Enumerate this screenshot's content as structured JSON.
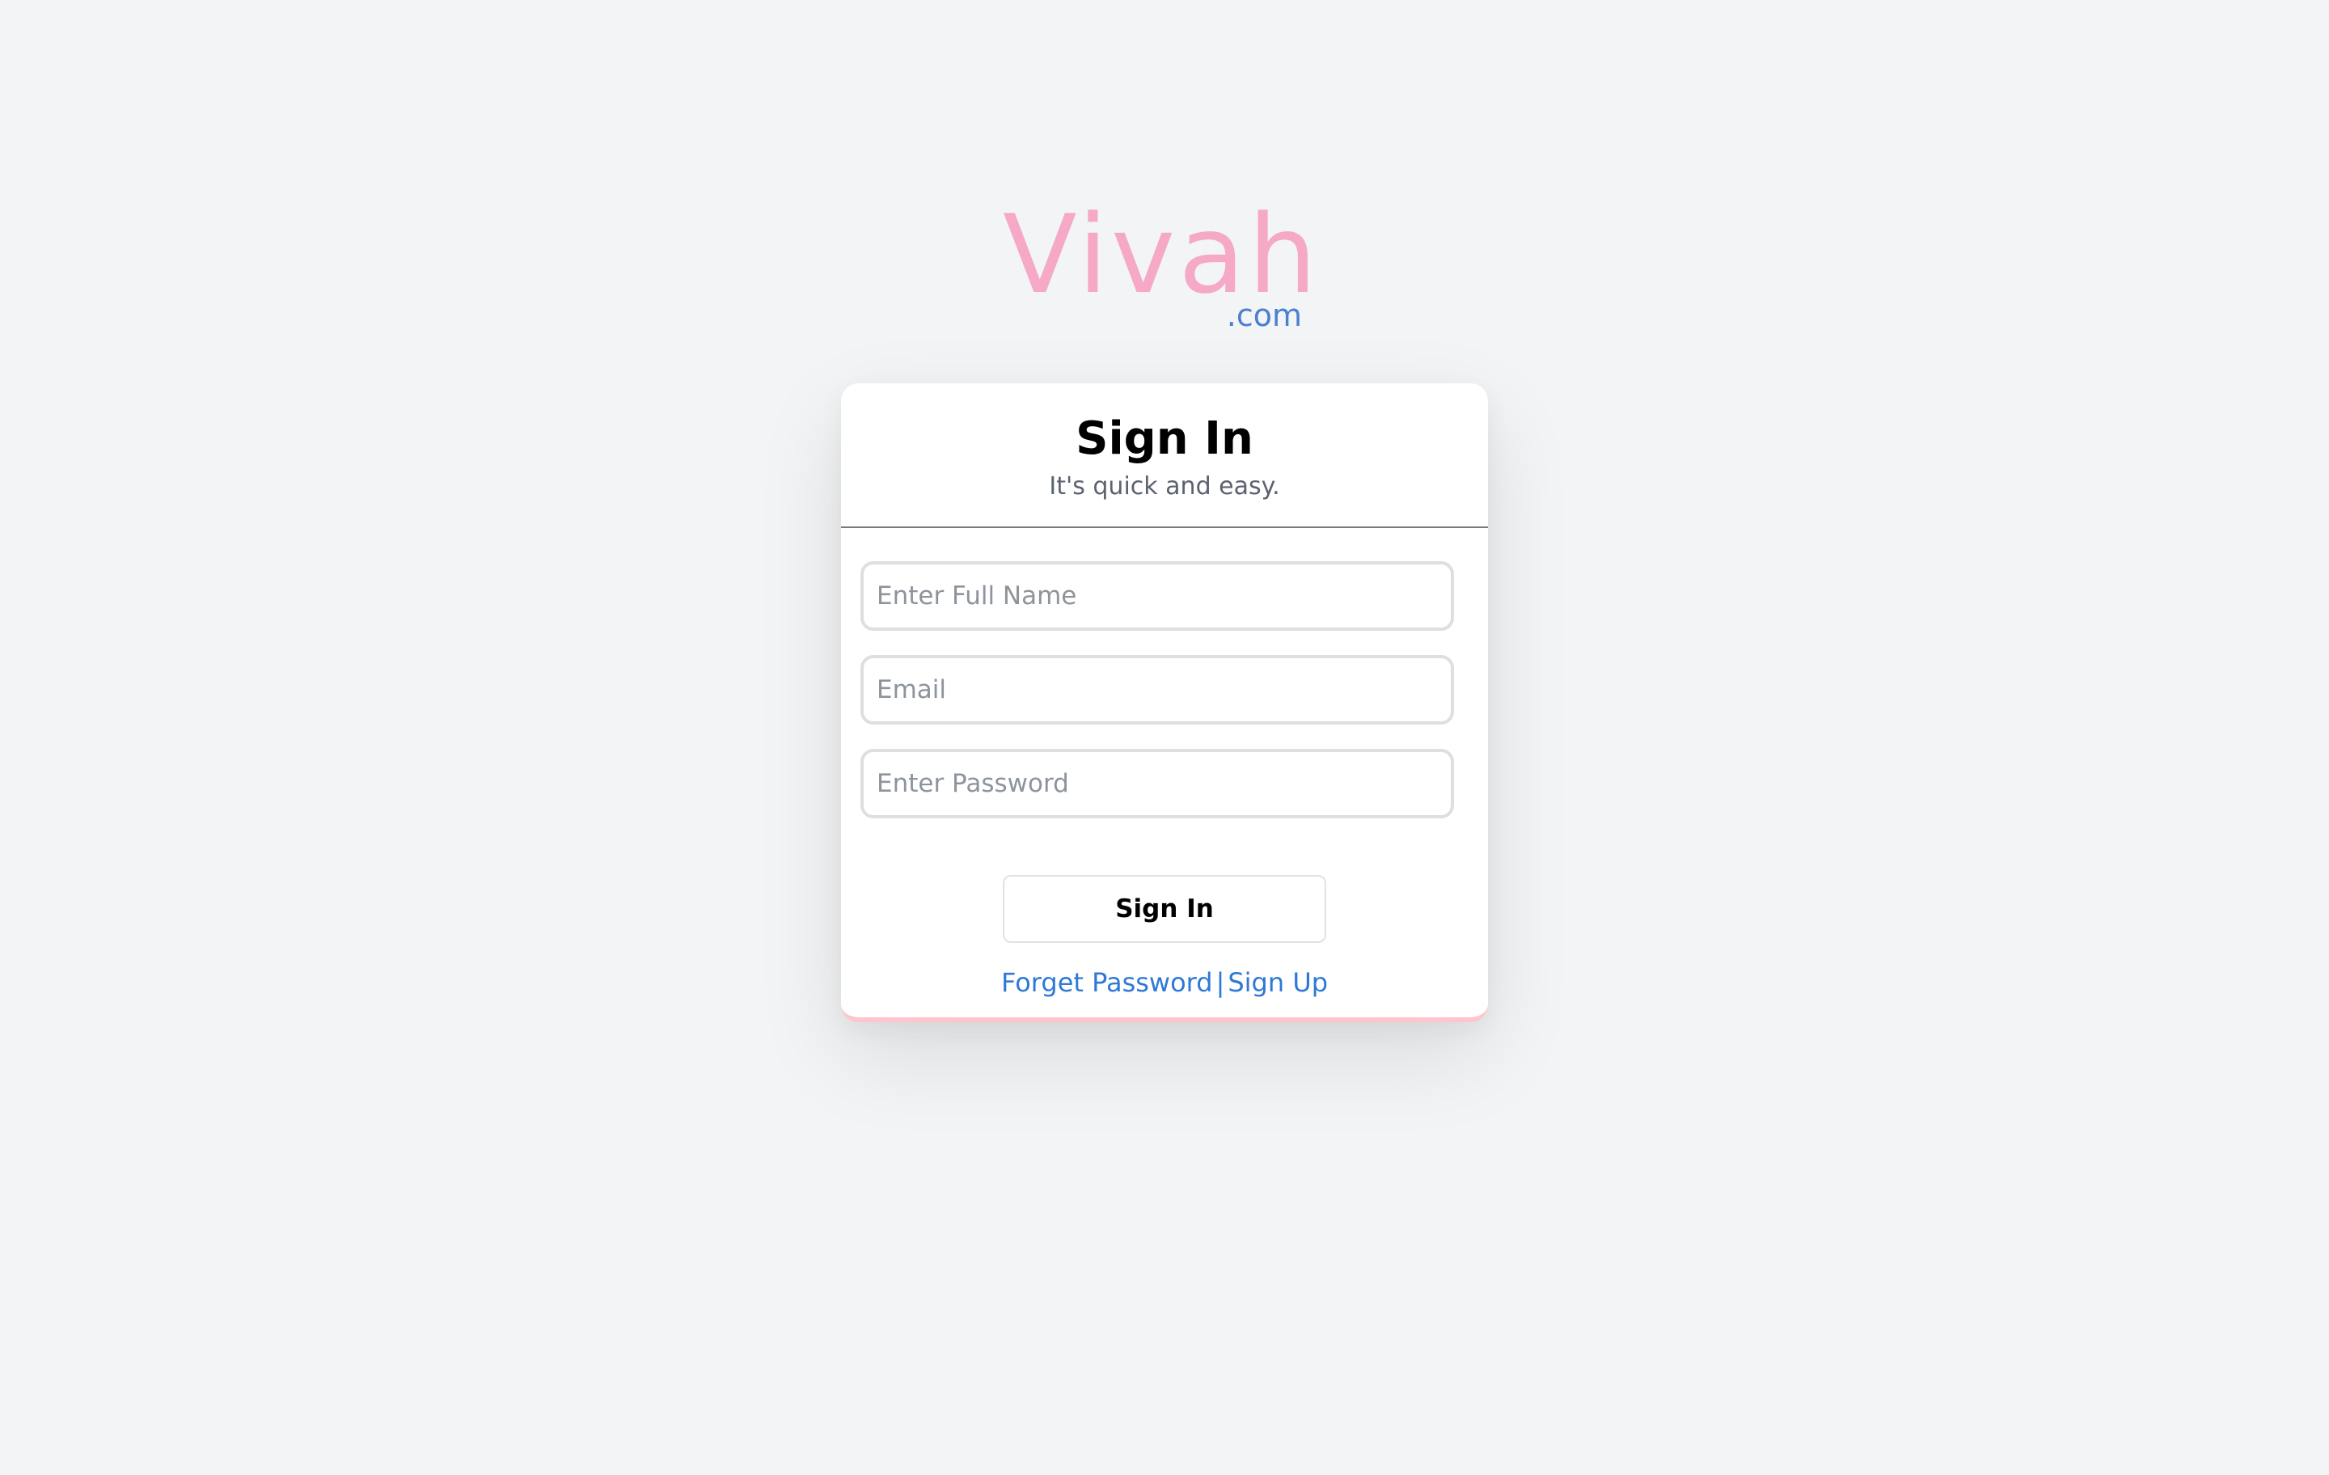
{
  "brand": {
    "name": "Vivah",
    "suffix": ".com",
    "colors": {
      "name": "#f5a9c7",
      "suffix": "#4a7fd1"
    }
  },
  "signin": {
    "title": "Sign In",
    "subtitle": "It's quick and easy.",
    "fields": {
      "full_name": {
        "placeholder": "Enter Full Name",
        "value": ""
      },
      "email": {
        "placeholder": "Email",
        "value": ""
      },
      "password": {
        "placeholder": "Enter Password",
        "value": ""
      }
    },
    "submit_label": "Sign In",
    "links": {
      "forgot": "Forget Password",
      "separator": "|",
      "signup": "Sign Up"
    }
  },
  "colors": {
    "background": "#f3f4f6",
    "card": "#ffffff",
    "card_bottom_accent": "#ffc4cc",
    "link": "#2f79d6"
  }
}
